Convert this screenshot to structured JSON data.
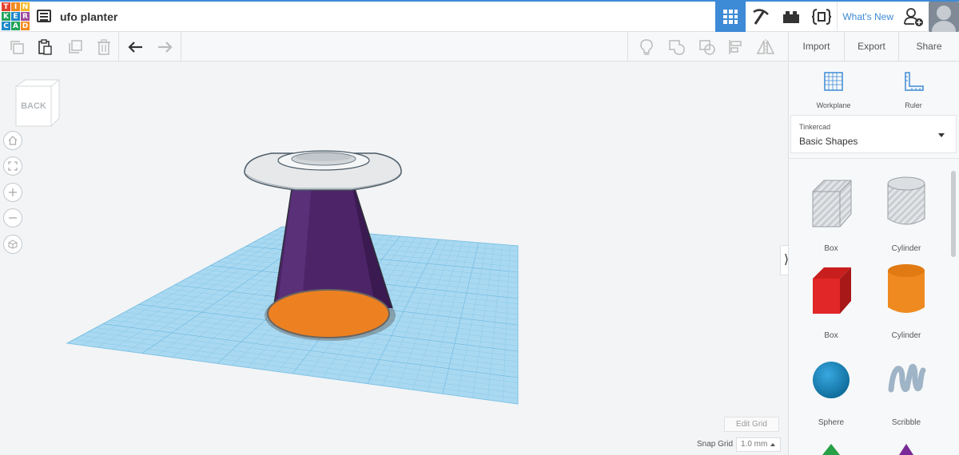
{
  "app": {
    "logo_letters": [
      "T",
      "I",
      "N",
      "K",
      "E",
      "R",
      "C",
      "A",
      "D"
    ],
    "logo_colors": [
      "#e2412f",
      "#f28a1e",
      "#f3b927",
      "#21a25a",
      "#1e88c9",
      "#9c4a9c",
      "#1e88c9",
      "#21a25a",
      "#f28a1e"
    ],
    "brand_color": "#3d8ad6"
  },
  "header": {
    "title": "ufo planter",
    "whats_new": "What's New",
    "view_icons": [
      "grid-view-icon",
      "pickaxe-icon",
      "bricks-icon",
      "codeblocks-icon"
    ]
  },
  "toolbar": {
    "import_label": "Import",
    "export_label": "Export",
    "share_label": "Share"
  },
  "viewport": {
    "viewcube_label": "BACK",
    "edit_grid_label": "Edit Grid",
    "snap_grid_label": "Snap Grid",
    "snap_grid_value": "1.0 mm",
    "nav_icons": [
      "home-icon",
      "fit-view-icon",
      "zoom-in-icon",
      "zoom-out-icon",
      "perspective-icon"
    ]
  },
  "panel": {
    "workplane_label": "Workplane",
    "ruler_label": "Ruler",
    "category_source": "Tinkercad",
    "category_name": "Basic Shapes",
    "shapes": [
      {
        "label": "Box",
        "icon": "box-hole-icon"
      },
      {
        "label": "Cylinder",
        "icon": "cylinder-hole-icon"
      },
      {
        "label": "Box",
        "icon": "box-solid-icon"
      },
      {
        "label": "Cylinder",
        "icon": "cylinder-solid-icon"
      },
      {
        "label": "Sphere",
        "icon": "sphere-icon"
      },
      {
        "label": "Scribble",
        "icon": "scribble-icon"
      }
    ]
  }
}
